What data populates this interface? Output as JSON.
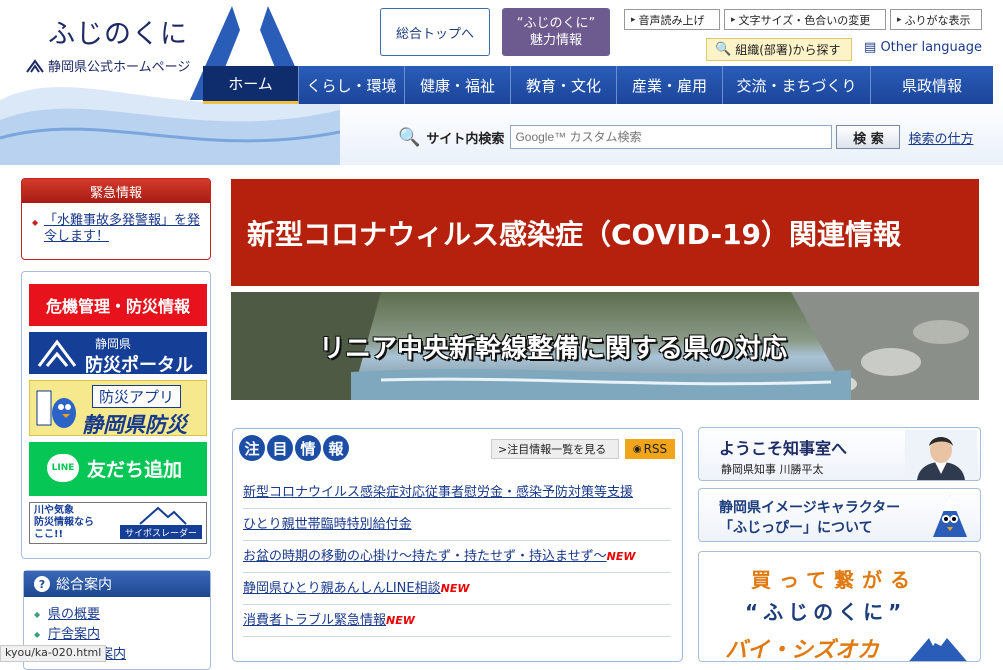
{
  "header": {
    "logo_title": "ふじのくに",
    "logo_subtitle": "静岡県公式ホームページ",
    "top_button": "総合トップへ",
    "charm_button_line1": "“ふじのくに”",
    "charm_button_line2": "魅力情報",
    "voice": "音声読み上げ",
    "font_size": "文字サイズ・色合いの変更",
    "furigana": "ふりがな表示",
    "org_search": "組織(部署)から探す",
    "other_language": "Other language"
  },
  "nav": [
    {
      "label": "ホーム",
      "active": true
    },
    {
      "label": "くらし・環境"
    },
    {
      "label": "健康・福祉"
    },
    {
      "label": "教育・文化"
    },
    {
      "label": "産業・雇用"
    },
    {
      "label": "交流・まちづくり"
    },
    {
      "label": "県政情報"
    }
  ],
  "search": {
    "label": "サイト内検索",
    "placeholder": "Google™ カスタム検索",
    "button": "検 索",
    "help": "検索の仕方"
  },
  "emergency": {
    "title": "緊急情報",
    "item": "「水難事故多発警報」を発令します！"
  },
  "disaster_banners": {
    "crisis": "危機管理・防災情報",
    "portal_line1": "静岡県",
    "portal_line2": "防災ポータル",
    "app_line1": "防災アプリ",
    "app_line2": "静岡県防災",
    "line_badge": "LINE",
    "line_text": "友だち追加",
    "river_text": "川や気象\n防災情報なら\nここ!!",
    "river_tag": "サイポスレーダー"
  },
  "guide": {
    "title": "総合案内",
    "links": [
      "県の概要",
      "庁舎案内",
      "県の機関案内"
    ]
  },
  "status_url": "kyou/ka-020.html",
  "banners": {
    "covid": "新型コロナウィルス感染症（COVID-19）関連情報",
    "linear": "リニア中央新幹線整備に関する県の対応"
  },
  "news": {
    "title_chars": [
      "注",
      "目",
      "情",
      "報"
    ],
    "more": ">注目情報一覧を見る",
    "rss": "RSS",
    "items": [
      {
        "text": "新型コロナウイルス感染症対応従事者慰労金・感染予防対策等支援",
        "new": ""
      },
      {
        "text": "ひとり親世帯臨時特別給付金",
        "new": ""
      },
      {
        "text": "お盆の時期の移動の心掛け～持たず・持たせず・持込ませず～",
        "new": "NEW"
      },
      {
        "text": "静岡県ひとり親あんしんLINE相談",
        "new": "NEW"
      },
      {
        "text": "消費者トラブル緊急情報",
        "new": "NEW"
      }
    ]
  },
  "right": {
    "governor_title": "ようこそ知事室へ",
    "governor_sub": "静岡県知事 川勝平太",
    "mascot_line1": "静岡県イメージキャラクター",
    "mascot_line2": "「ふじっぴー」について",
    "buy_line1": "買って繋がる",
    "buy_line2": "“ふじのくに”",
    "buy_line3": "バイ・シズオカ"
  },
  "colors": {
    "nav_blue": "#1c459a",
    "covid_red": "#b5210c",
    "emergency_red": "#c32222",
    "link_blue": "#1a3a8a",
    "line_green": "#06c755"
  }
}
